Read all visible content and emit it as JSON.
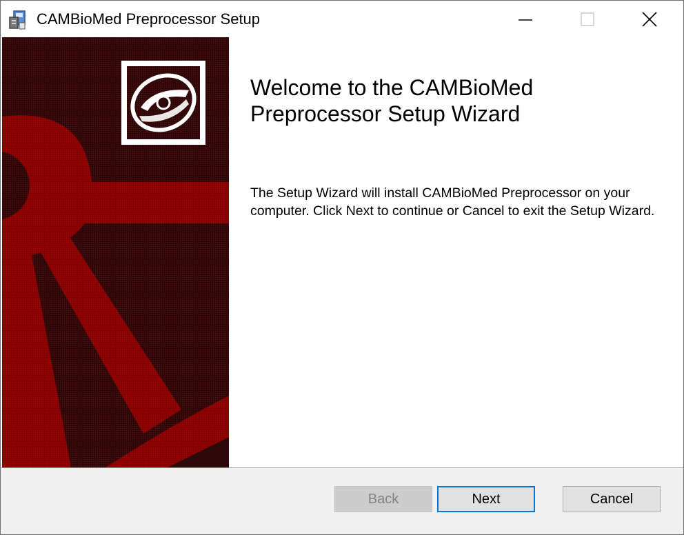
{
  "window": {
    "title": "CAMBioMed Preprocessor Setup",
    "icon": "installer-package-icon",
    "controls": {
      "minimize": "minimize-icon",
      "maximize": "maximize-icon",
      "close": "close-icon"
    }
  },
  "side_panel": {
    "logo": "disc-icon",
    "colors": {
      "dark": "#3a0a0a",
      "accent": "#8b0000"
    }
  },
  "content": {
    "heading": "Welcome to the CAMBioMed Preprocessor Setup Wizard",
    "body": "The Setup Wizard will install CAMBioMed Preprocessor on your computer. Click Next to continue or Cancel to exit the Setup Wizard."
  },
  "buttons": {
    "back": "Back",
    "next": "Next",
    "cancel": "Cancel"
  },
  "colors": {
    "focus": "#0078d7"
  }
}
